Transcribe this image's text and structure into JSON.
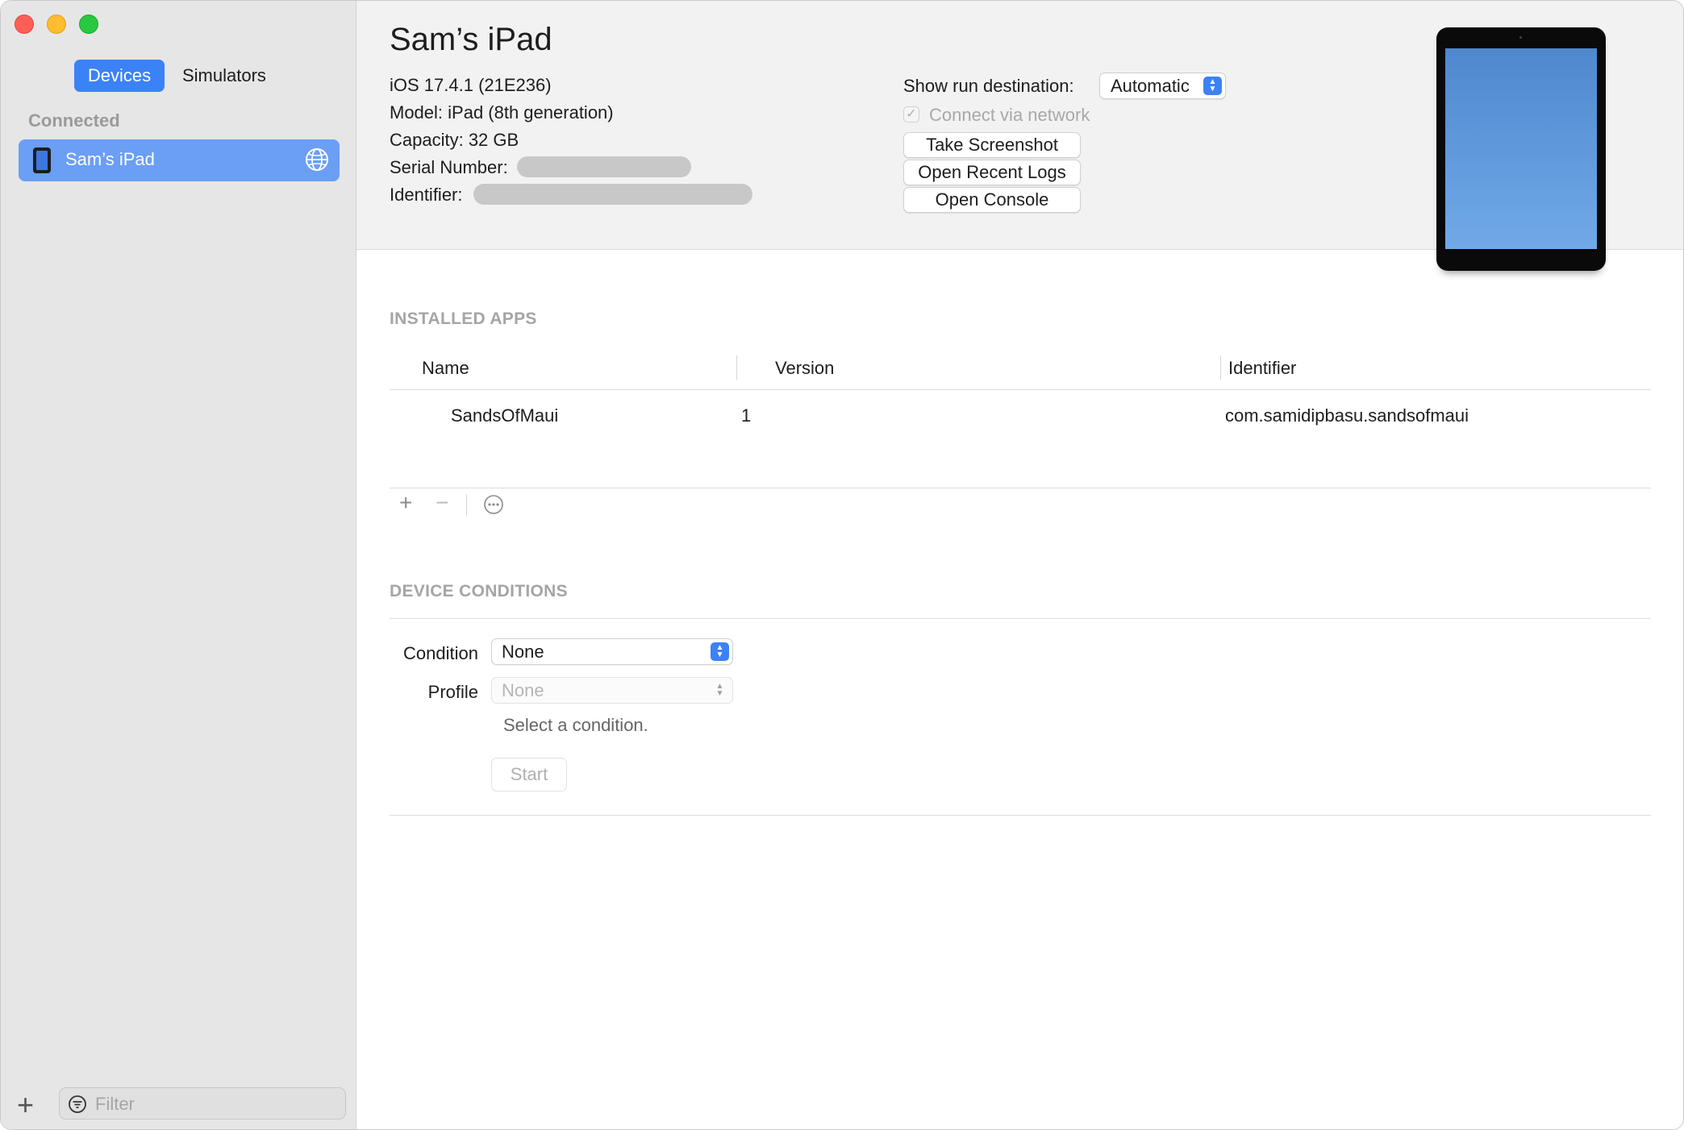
{
  "sidebar": {
    "tabs": {
      "devices": "Devices",
      "simulators": "Simulators"
    },
    "section_label": "Connected",
    "device": {
      "name": "Sam’s iPad",
      "icon": "ipad-icon",
      "status_icon": "globe-icon"
    },
    "filter_placeholder": "Filter"
  },
  "header": {
    "title": "Sam’s iPad",
    "ios": "iOS 17.4.1 (21E236)",
    "model": "Model: iPad (8th generation)",
    "capacity": "Capacity: 32 GB",
    "serial_label": "Serial Number:",
    "identifier_label": "Identifier:",
    "run_destination_label": "Show run destination:",
    "run_destination_value": "Automatic",
    "connect_network": {
      "label": "Connect via network",
      "checked": true,
      "check_mark": "✓"
    },
    "buttons": {
      "screenshot": "Take Screenshot",
      "logs": "Open Recent Logs",
      "console": "Open Console"
    }
  },
  "installed_apps": {
    "title": "INSTALLED APPS",
    "columns": {
      "name": "Name",
      "version": "Version",
      "identifier": "Identifier"
    },
    "rows": [
      {
        "name": "SandsOfMaui",
        "version": "1",
        "identifier": "com.samidipbasu.sandsofmaui"
      }
    ],
    "toolbar": {
      "add": "+",
      "remove": "−"
    }
  },
  "device_conditions": {
    "title": "DEVICE CONDITIONS",
    "condition_label": "Condition",
    "condition_value": "None",
    "profile_label": "Profile",
    "profile_value": "None",
    "hint": "Select a condition.",
    "start": "Start"
  },
  "colors": {
    "accent": "#3b82f6",
    "selection": "#6b9ef5"
  }
}
